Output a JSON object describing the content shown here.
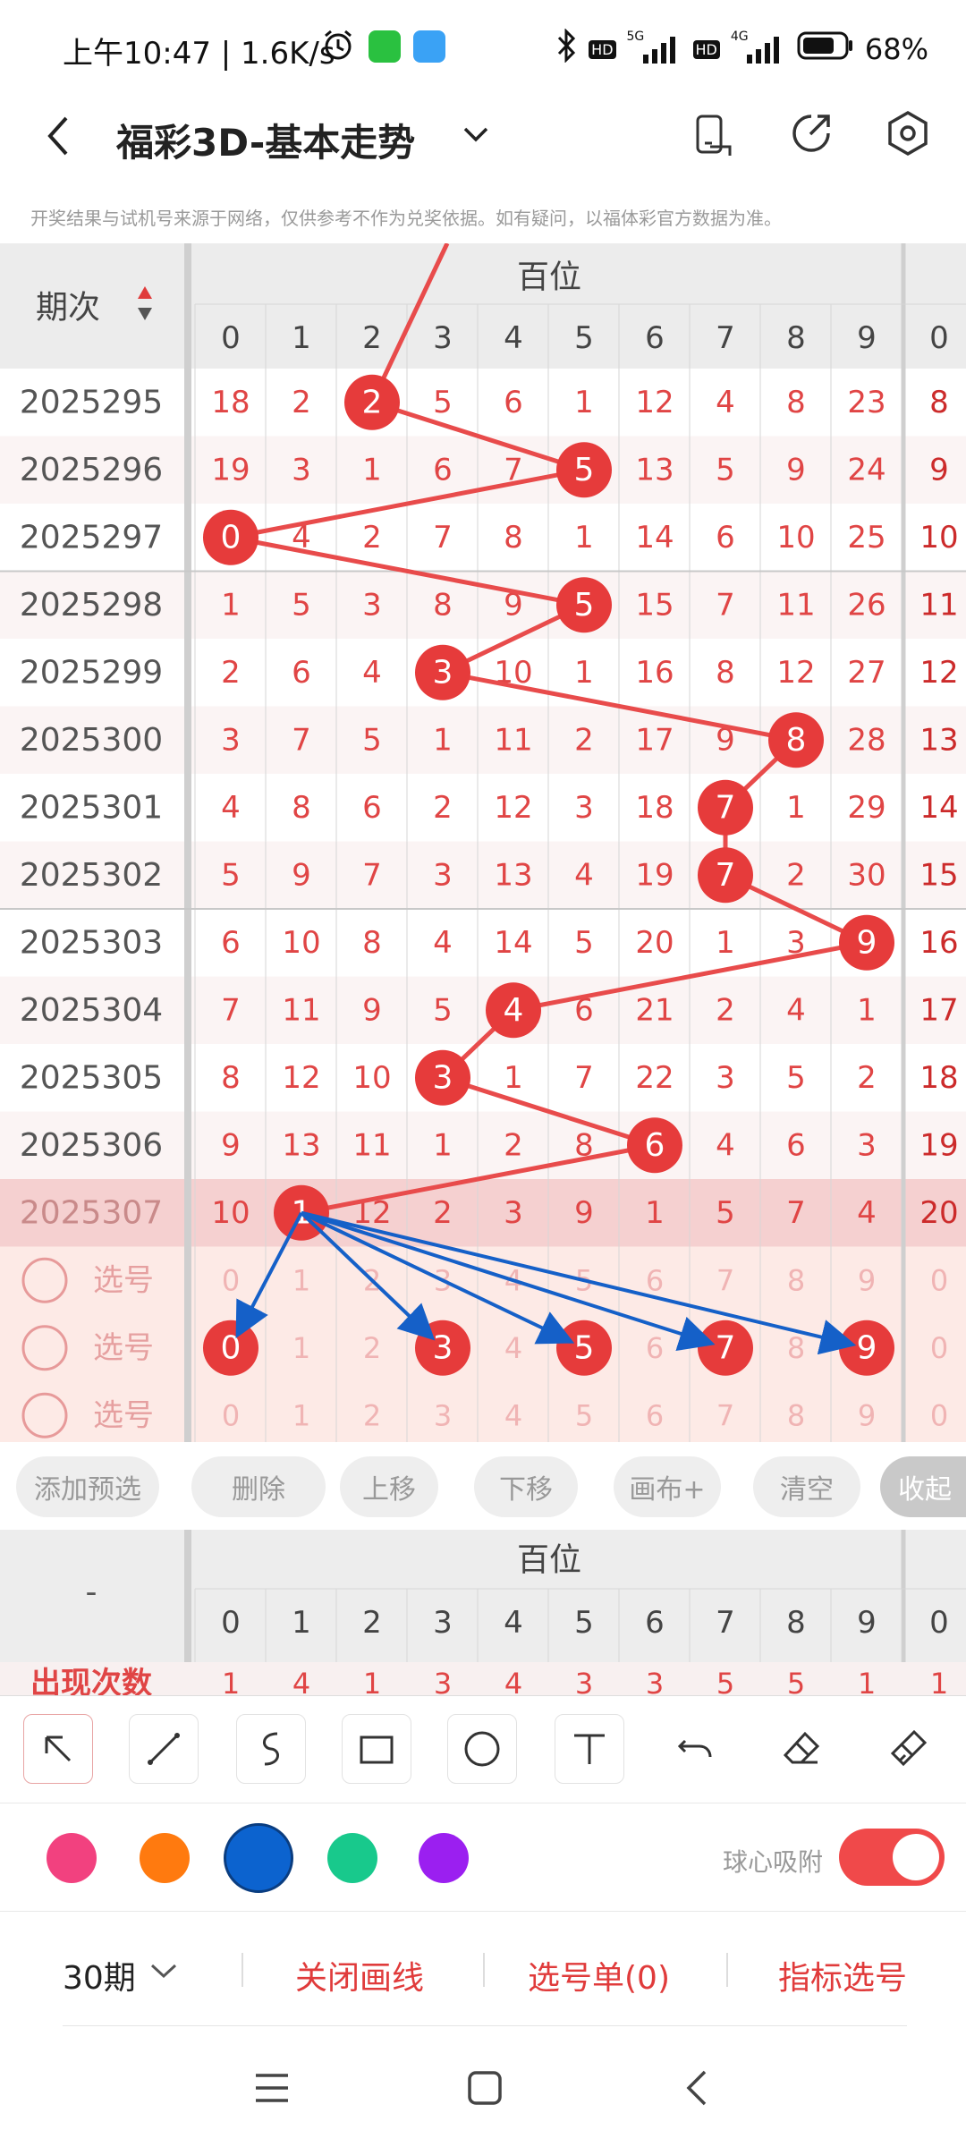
{
  "status_bar": {
    "time": "上午10:47 | 1.6K/s",
    "battery": "68%",
    "net_label_1": "5G",
    "net_label_2": "4G",
    "hd": "HD"
  },
  "header": {
    "title": "福彩3D-基本走势"
  },
  "notice": "开奖结果与试机号来源于网络，仅供参考不作为兑奖依据。如有疑问，以福体彩官方数据为准。",
  "table": {
    "period_header": "期次",
    "group_title": "百位",
    "digit_headers": [
      "0",
      "1",
      "2",
      "3",
      "4",
      "5",
      "6",
      "7",
      "8",
      "9",
      "0"
    ],
    "rows": [
      {
        "period": "2025295",
        "cells": [
          "18",
          "2",
          "2",
          "5",
          "6",
          "1",
          "12",
          "4",
          "8",
          "23",
          "8"
        ],
        "hit": 2
      },
      {
        "period": "2025296",
        "cells": [
          "19",
          "3",
          "1",
          "6",
          "7",
          "5",
          "13",
          "5",
          "9",
          "24",
          "9"
        ],
        "hit": 5
      },
      {
        "period": "2025297",
        "cells": [
          "0",
          "4",
          "2",
          "7",
          "8",
          "1",
          "14",
          "6",
          "10",
          "25",
          "10"
        ],
        "hit": 0
      },
      {
        "period": "2025298",
        "cells": [
          "1",
          "5",
          "3",
          "8",
          "9",
          "5",
          "15",
          "7",
          "11",
          "26",
          "11"
        ],
        "hit": 5
      },
      {
        "period": "2025299",
        "cells": [
          "2",
          "6",
          "4",
          "3",
          "10",
          "1",
          "16",
          "8",
          "12",
          "27",
          "12"
        ],
        "hit": 3
      },
      {
        "period": "2025300",
        "cells": [
          "3",
          "7",
          "5",
          "1",
          "11",
          "2",
          "17",
          "9",
          "8",
          "28",
          "13"
        ],
        "hit": 8
      },
      {
        "period": "2025301",
        "cells": [
          "4",
          "8",
          "6",
          "2",
          "12",
          "3",
          "18",
          "7",
          "1",
          "29",
          "14"
        ],
        "hit": 7
      },
      {
        "period": "2025302",
        "cells": [
          "5",
          "9",
          "7",
          "3",
          "13",
          "4",
          "19",
          "7",
          "2",
          "30",
          "15"
        ],
        "hit": 7
      },
      {
        "period": "2025303",
        "cells": [
          "6",
          "10",
          "8",
          "4",
          "14",
          "5",
          "20",
          "1",
          "3",
          "9",
          "16"
        ],
        "hit": 9
      },
      {
        "period": "2025304",
        "cells": [
          "7",
          "11",
          "9",
          "5",
          "4",
          "6",
          "21",
          "2",
          "4",
          "1",
          "17"
        ],
        "hit": 4
      },
      {
        "period": "2025305",
        "cells": [
          "8",
          "12",
          "10",
          "3",
          "1",
          "7",
          "22",
          "3",
          "5",
          "2",
          "18"
        ],
        "hit": 3
      },
      {
        "period": "2025306",
        "cells": [
          "9",
          "13",
          "11",
          "1",
          "2",
          "8",
          "6",
          "4",
          "6",
          "3",
          "19"
        ],
        "hit": 6
      },
      {
        "period": "2025307",
        "cells": [
          "10",
          "1",
          "12",
          "2",
          "3",
          "9",
          "1",
          "5",
          "7",
          "4",
          "20"
        ],
        "hit": 1
      }
    ],
    "select_rows": [
      {
        "label": "选号",
        "cells": [
          "0",
          "1",
          "2",
          "3",
          "4",
          "5",
          "6",
          "7",
          "8",
          "9",
          "0"
        ],
        "marked": []
      },
      {
        "label": "选号",
        "cells": [
          "0",
          "1",
          "2",
          "3",
          "4",
          "5",
          "6",
          "7",
          "8",
          "9",
          "0"
        ],
        "marked": [
          0,
          3,
          5,
          7,
          9
        ]
      },
      {
        "label": "选号",
        "cells": [
          "0",
          "1",
          "2",
          "3",
          "4",
          "5",
          "6",
          "7",
          "8",
          "9",
          "0"
        ],
        "marked": []
      }
    ]
  },
  "buttons": [
    "添加预选",
    "删除",
    "上移",
    "下移",
    "画布+",
    "清空",
    "收起"
  ],
  "summary": {
    "left_label": "-",
    "group_title": "百位",
    "digit_headers": [
      "0",
      "1",
      "2",
      "3",
      "4",
      "5",
      "6",
      "7",
      "8",
      "9",
      "0"
    ],
    "row_label": "出现次数",
    "row_values": [
      "1",
      "4",
      "1",
      "3",
      "4",
      "3",
      "3",
      "5",
      "5",
      "1",
      "1"
    ]
  },
  "tools": [
    "pointer-icon",
    "line-icon",
    "curve-icon",
    "rectangle-icon",
    "circle-icon",
    "text-icon",
    "undo-icon",
    "eraser-icon",
    "clear-brush-icon"
  ],
  "colors": [
    "#f2417f",
    "#ff7a0f",
    "#0c63cf",
    "#18c98c",
    "#9b1ff0"
  ],
  "snap_label": "球心吸附",
  "bottom": {
    "periods": "30期",
    "close_lines": "关闭画线",
    "selection": "选号单(0)",
    "indicator": "指标选号"
  }
}
